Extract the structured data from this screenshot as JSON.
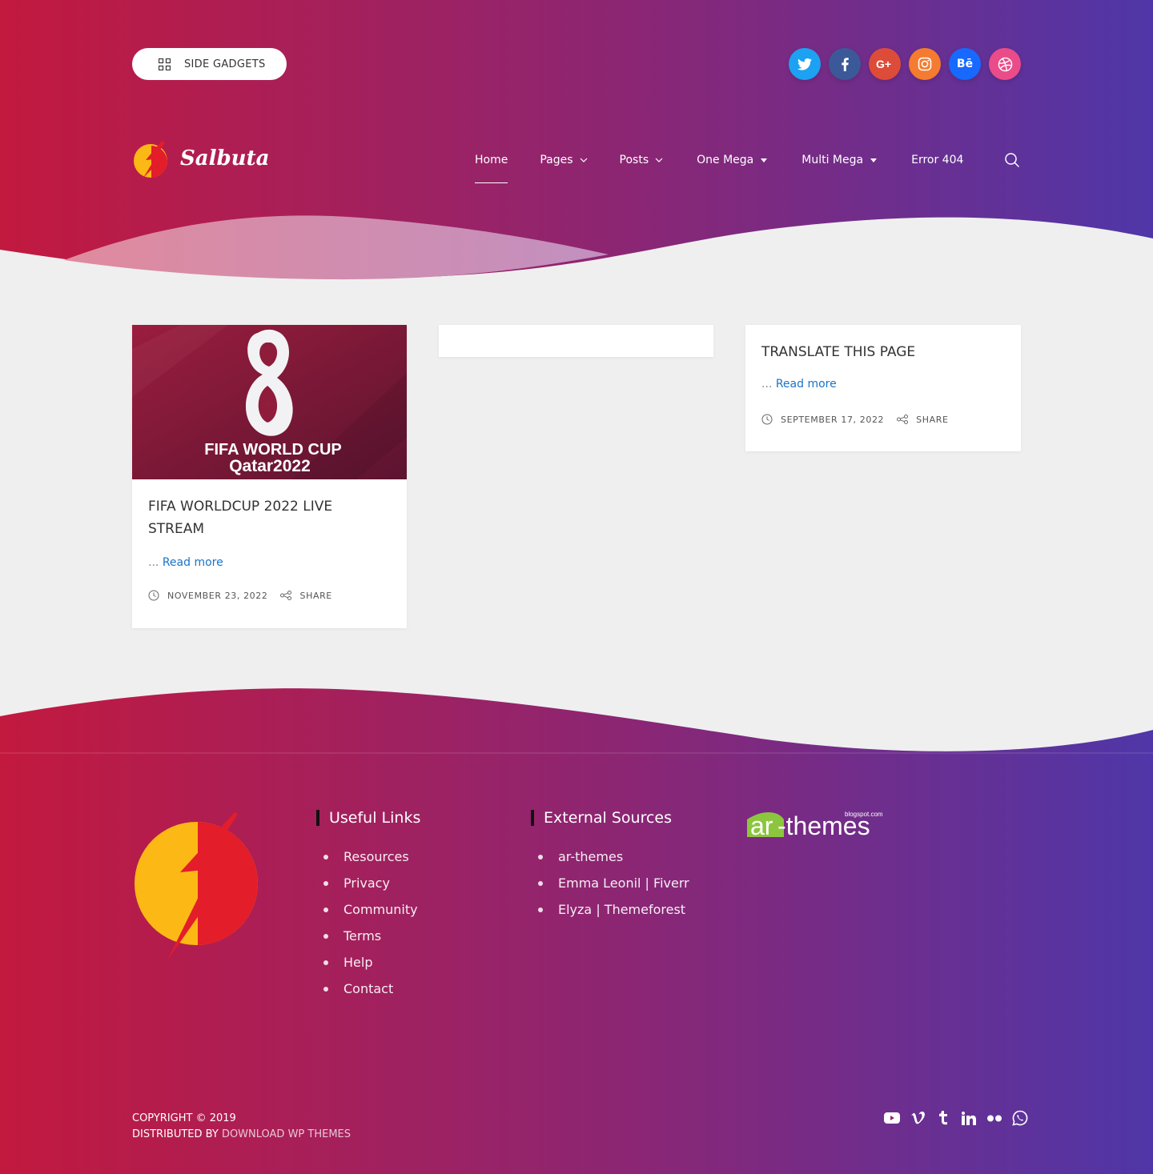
{
  "header": {
    "side_gadgets_label": "SIDE GADGETS",
    "logo_text": "Salbuta",
    "social_icons": [
      "twitter-icon",
      "facebook-icon",
      "google-plus-icon",
      "instagram-icon",
      "behance-icon",
      "dribbble-icon"
    ],
    "social_colors": {
      "twitter": "#1da1f2",
      "facebook": "#3b5998",
      "google_plus": "#dd4b39",
      "instagram": "#f47b2f",
      "behance": "#1769ff",
      "dribbble": "#ea4c89"
    },
    "behance_glyph": "Bē",
    "nav": [
      {
        "label": "Home",
        "active": true
      },
      {
        "label": "Pages",
        "dropdown": "chevron"
      },
      {
        "label": "Posts",
        "dropdown": "chevron"
      },
      {
        "label": "One Mega",
        "dropdown": "triangle"
      },
      {
        "label": "Multi Mega",
        "dropdown": "triangle"
      },
      {
        "label": "Error 404"
      }
    ]
  },
  "theme": {
    "gradient_start": "#c2193f",
    "gradient_end": "#4f36a8",
    "link_color": "#1a73c9"
  },
  "posts": [
    {
      "image_caption_line1": "FIFA WORLD CUP",
      "image_caption_line2": "Qatar2022",
      "title": "FIFA WORLDCUP 2022 LIVE STREAM",
      "excerpt_prefix": "...",
      "read_more": "Read more",
      "date": "NOVEMBER 23, 2022",
      "share": "SHARE"
    },
    {},
    {
      "title": "TRANSLATE THIS PAGE",
      "excerpt_prefix": "...",
      "read_more": "Read more",
      "date": "SEPTEMBER 17, 2022",
      "share": "SHARE"
    }
  ],
  "footer": {
    "useful_links": {
      "heading": "Useful Links",
      "items": [
        "Resources",
        "Privacy",
        "Community",
        "Terms",
        "Help",
        "Contact"
      ]
    },
    "external_sources": {
      "heading": "External Sources",
      "items": [
        "ar-themes",
        "Emma Leonil | Fiverr",
        "Elyza | Themeforest"
      ]
    },
    "ar_themes_logo": {
      "small": "blogspot.com",
      "main_prefix": "ar",
      "main_suffix": "-themes"
    },
    "copyright": "COPYRIGHT © 2019",
    "distributed_prefix": "DISTRIBUTED BY",
    "distributed_link": "DOWNLOAD WP THEMES",
    "social_icons": [
      "youtube-icon",
      "vimeo-icon",
      "tumblr-icon",
      "linkedin-icon",
      "flickr-icon",
      "whatsapp-icon"
    ]
  }
}
